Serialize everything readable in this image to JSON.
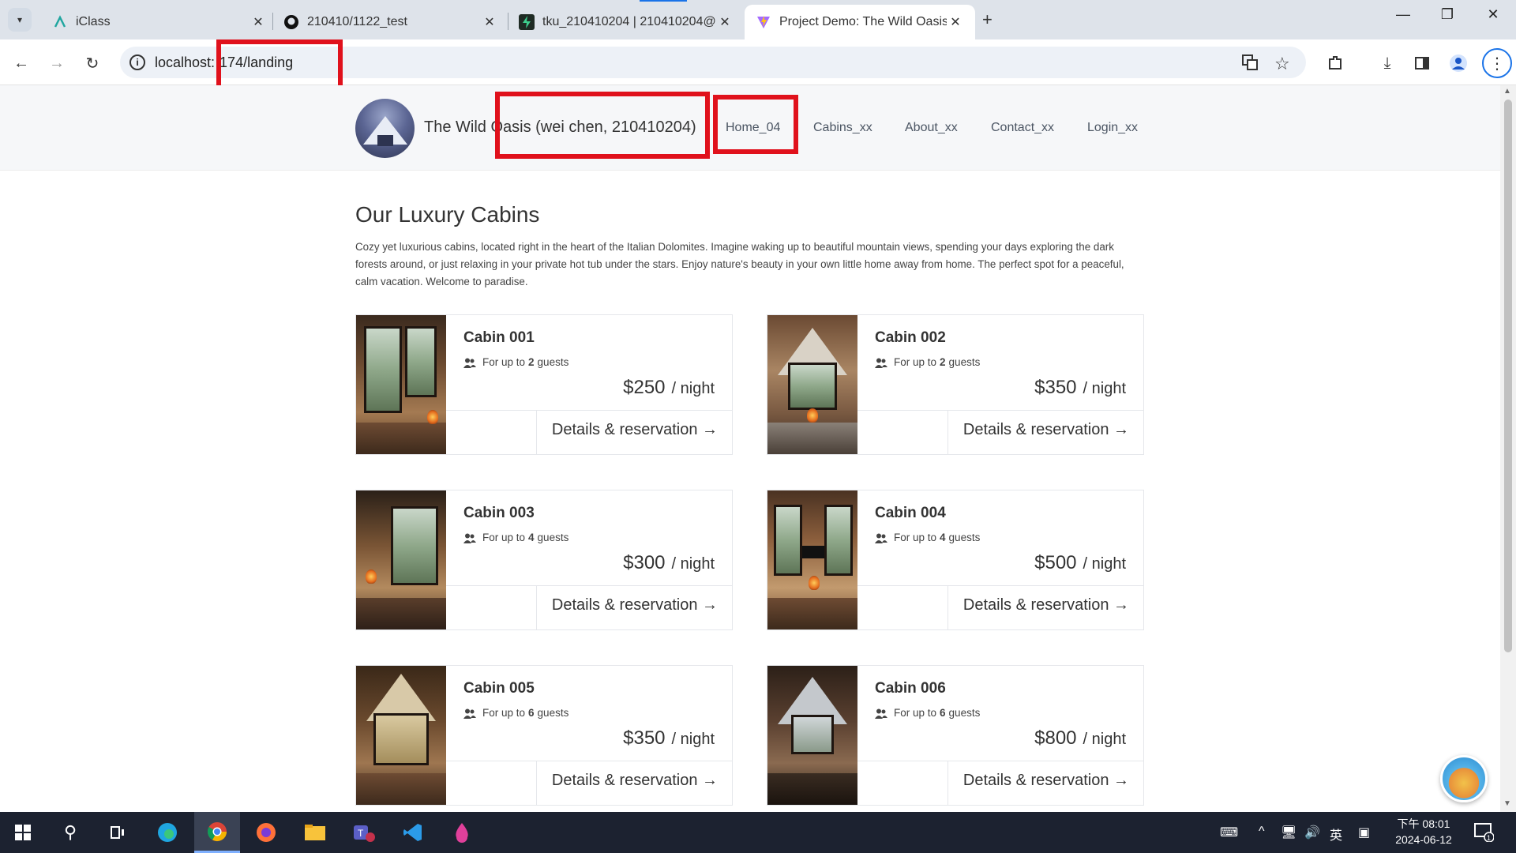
{
  "browser": {
    "tabs": [
      {
        "title": "iClass",
        "icon": "iclass-icon"
      },
      {
        "title": "210410/1122_test",
        "icon": "github-icon"
      },
      {
        "title": "tku_210410204 | 210410204@",
        "icon": "supabase-icon"
      },
      {
        "title": "Project Demo: The Wild Oasis",
        "icon": "vite-icon",
        "active": true
      }
    ],
    "url_host": "localhost:",
    "url_path": "174/landing"
  },
  "header": {
    "brand": "The Wild Oasis (wei chen, 210410204)",
    "nav": [
      "Home_04",
      "Cabins_xx",
      "About_xx",
      "Contact_xx",
      "Login_xx"
    ]
  },
  "main": {
    "title": "Our Luxury Cabins",
    "intro": "Cozy yet luxurious cabins, located right in the heart of the Italian Dolomites. Imagine waking up to beautiful mountain views, spending your days exploring the dark forests around, or just relaxing in your private hot tub under the stars. Enjoy nature's beauty in your own little home away from home. The perfect spot for a peaceful, calm vacation. Welcome to paradise.",
    "guests_prefix": "For up to",
    "guests_suffix": "guests",
    "per_night": "/ night",
    "details_label": "Details & reservation →",
    "cabins": [
      {
        "name": "Cabin 001",
        "guests": "2",
        "price": "$250"
      },
      {
        "name": "Cabin 002",
        "guests": "2",
        "price": "$350"
      },
      {
        "name": "Cabin 003",
        "guests": "4",
        "price": "$300"
      },
      {
        "name": "Cabin 004",
        "guests": "4",
        "price": "$500"
      },
      {
        "name": "Cabin 005",
        "guests": "6",
        "price": "$350"
      },
      {
        "name": "Cabin 006",
        "guests": "6",
        "price": "$800"
      }
    ]
  },
  "taskbar": {
    "clock_period_time": "下午 08:01",
    "date": "2024-06-12",
    "ime": "英",
    "notification_count": "1"
  },
  "colors": {
    "highlight_box": "#e0111c",
    "nav_text": "#4b5563",
    "header_bg": "#f6f7f9"
  }
}
